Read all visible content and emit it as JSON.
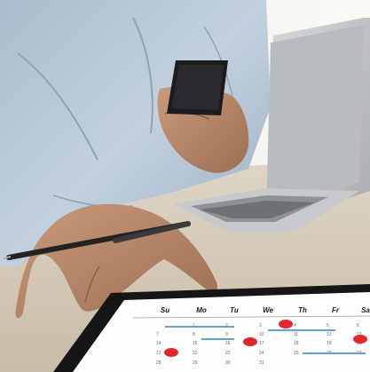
{
  "calendar": {
    "day_labels": [
      "Su",
      "Mo",
      "Tu",
      "We",
      "Th",
      "Fr",
      "Sa"
    ],
    "date_rows": [
      [
        "",
        "1",
        "2",
        "3",
        "4",
        "5",
        "6"
      ],
      [
        "7",
        "8",
        "9",
        "10",
        "11",
        "12",
        "13"
      ],
      [
        "14",
        "15",
        "16",
        "17",
        "18",
        "19",
        "20"
      ],
      [
        "21",
        "22",
        "23",
        "24",
        "25",
        "26",
        "27"
      ],
      [
        "28",
        "29",
        "30",
        "31",
        "",
        "",
        ""
      ]
    ],
    "event_marker_color": "#e3262b",
    "event_bar_color": "#5fa4cf"
  },
  "scene": {
    "subject": "person at desk using smartphone with laptop, pen and tablet calendar",
    "colors": {
      "shirt": "#b8c8d8",
      "skin": "#b98a6c",
      "desk": "#d9cfbf",
      "laptop": "#c4c6c8",
      "phone": "#1c1c1e",
      "pen": "#232323",
      "tablet_bezel": "#161616"
    }
  }
}
